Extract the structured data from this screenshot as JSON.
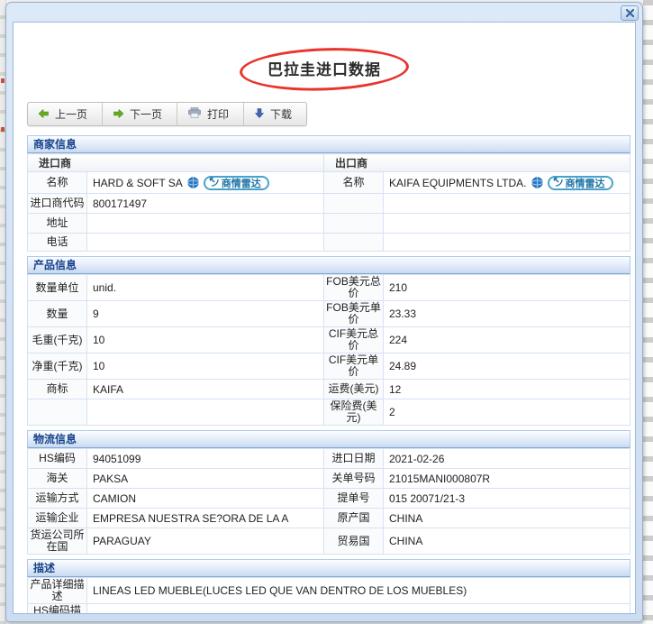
{
  "page_title": "巴拉圭进口数据",
  "window": {
    "close_icon": "close-x"
  },
  "toolbar": {
    "prev_label": "上一页",
    "next_label": "下一页",
    "print_label": "打印",
    "download_label": "下载"
  },
  "badge": {
    "label": "商情雷达"
  },
  "sections": {
    "merchant": {
      "title": "商家信息",
      "importer_header": "进口商",
      "exporter_header": "出口商",
      "name_label": "名称",
      "importer_name": "HARD & SOFT SA",
      "exporter_name": "KAIFA EQUIPMENTS LTDA.",
      "importer_code_label": "进口商代码",
      "importer_code": "800171497",
      "address_label": "地址",
      "address_value": "",
      "phone_label": "电话",
      "phone_value": ""
    },
    "product": {
      "title": "产品信息",
      "rows": [
        {
          "l1": "数量单位",
          "v1": "unid.",
          "l2": "FOB美元总价",
          "v2": "210"
        },
        {
          "l1": "数量",
          "v1": "9",
          "l2": "FOB美元单价",
          "v2": "23.33"
        },
        {
          "l1": "毛重(千克)",
          "v1": "10",
          "l2": "CIF美元总价",
          "v2": "224"
        },
        {
          "l1": "净重(千克)",
          "v1": "10",
          "l2": "CIF美元单价",
          "v2": "24.89"
        },
        {
          "l1": "商标",
          "v1": "KAIFA",
          "l2": "运费(美元)",
          "v2": "12"
        },
        {
          "l1": "",
          "v1": "",
          "l2": "保险费(美元)",
          "v2": "2"
        }
      ]
    },
    "logistics": {
      "title": "物流信息",
      "rows": [
        {
          "l1": "HS编码",
          "v1": "94051099",
          "l2": "进口日期",
          "v2": "2021-02-26"
        },
        {
          "l1": "海关",
          "v1": "PAKSA",
          "l2": "关单号码",
          "v2": "21015MANI000807R"
        },
        {
          "l1": "运输方式",
          "v1": "CAMION",
          "l2": "提单号",
          "v2": "015 20071/21-3"
        },
        {
          "l1": "运输企业",
          "v1": "EMPRESA NUESTRA SE?ORA DE LA A",
          "l2": "原产国",
          "v2": "CHINA"
        },
        {
          "l1": "货运公司所在国",
          "v1": "PARAGUAY",
          "l2": "贸易国",
          "v2": "CHINA"
        }
      ]
    },
    "description": {
      "title": "描述",
      "rows": [
        {
          "label": "产品详细描述",
          "value": "LINEAS LED MUEBLE(LUCES LED QUE VAN DENTRO DE LOS MUEBLES)"
        },
        {
          "label": "HS编码描述",
          "value": ""
        }
      ]
    }
  },
  "colors": {
    "section_header_text": "#15428b",
    "table_border": "#d5e2f3",
    "red_ellipse": "#e8342b",
    "badge_border": "#49a3c8",
    "badge_text": "#1f74a8",
    "frame": "#ccdcf1"
  }
}
